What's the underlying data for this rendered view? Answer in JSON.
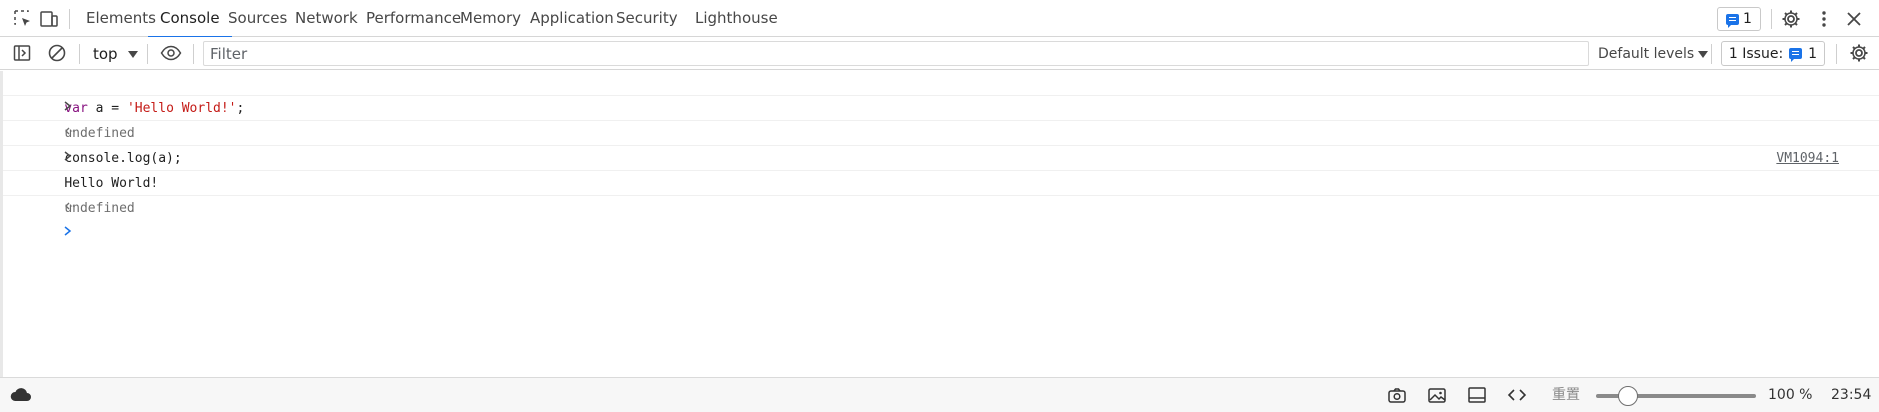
{
  "tabbar": {
    "tabs": [
      {
        "label": "Elements",
        "active": false
      },
      {
        "label": "Console",
        "active": true
      },
      {
        "label": "Sources",
        "active": false
      },
      {
        "label": "Network",
        "active": false
      },
      {
        "label": "Performance",
        "active": false
      },
      {
        "label": "Memory",
        "active": false
      },
      {
        "label": "Application",
        "active": false
      },
      {
        "label": "Security",
        "active": false
      },
      {
        "label": "Lighthouse",
        "active": false
      }
    ],
    "issues_count": "1",
    "icons": [
      "inspect-element-icon",
      "device-toolbar-icon",
      "settings-gear-icon",
      "more-vertical-icon",
      "close-icon"
    ]
  },
  "toolbar": {
    "context": "top",
    "filter_placeholder": "Filter",
    "filter_value": "",
    "levels_label": "Default levels",
    "issues_label": "1 Issue:",
    "issues_count": "1",
    "icons": [
      "sidebar-toggle-icon",
      "clear-console-icon",
      "live-expression-eye-icon",
      "console-settings-icon"
    ]
  },
  "console": {
    "rows": [
      {
        "type": "input",
        "parts": [
          {
            "t": "var",
            "c": "kw"
          },
          {
            "t": " a = ",
            "c": ""
          },
          {
            "t": "'Hello World!'",
            "c": "str"
          },
          {
            "t": ";",
            "c": ""
          }
        ]
      },
      {
        "type": "result",
        "text": "undefined"
      },
      {
        "type": "input",
        "text": "console.log(a);"
      },
      {
        "type": "log",
        "text": "Hello World!",
        "source": "VM1094:1"
      },
      {
        "type": "result",
        "text": "undefined"
      }
    ]
  },
  "statusbar": {
    "zoom_label": "重置",
    "zoom_value": "100 %",
    "zoom_level_percent": 100,
    "time": "23:54",
    "icons": [
      "cloud-icon",
      "camera-icon",
      "image-icon",
      "layout-icon",
      "code-icon"
    ]
  },
  "colors": {
    "accent": "#1a73e8",
    "keyword": "#881280",
    "string": "#c41a16"
  }
}
